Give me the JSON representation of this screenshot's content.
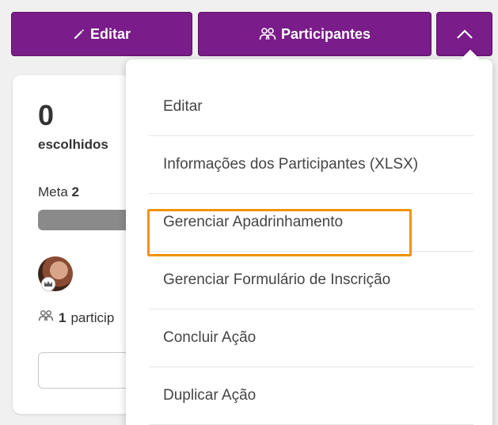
{
  "toolbar": {
    "edit_label": "Editar",
    "participants_label": "Participantes",
    "edit_icon": "pencil-icon",
    "participants_icon": "group-icon",
    "toggle_icon": "chevron-up-icon"
  },
  "card": {
    "count": "0",
    "count_label": "escolhidos",
    "meta_label": "Meta",
    "meta_value": "2",
    "progress_fraction": 1.0,
    "participants_count": "1",
    "participants_label": "particip"
  },
  "menu": {
    "items": [
      "Editar",
      "Informações dos Participantes (XLSX)",
      "Gerenciar Apadrinhamento",
      "Gerenciar Formulário de Inscrição",
      "Concluir Ação",
      "Duplicar Ação"
    ],
    "highlighted_index": 2
  },
  "colors": {
    "primary": "#7a1c8a",
    "highlight": "#f29400"
  }
}
